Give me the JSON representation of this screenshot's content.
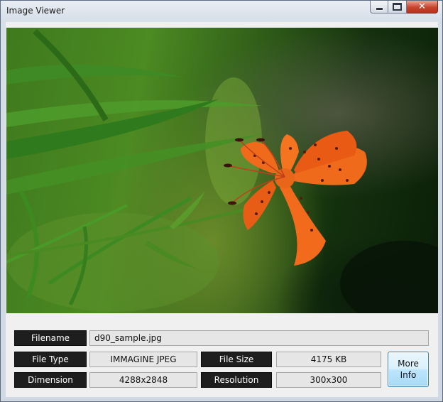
{
  "window": {
    "title": "Image Viewer"
  },
  "fields": {
    "filename": {
      "label": "Filename",
      "value": "d90_sample.jpg"
    },
    "file_type": {
      "label": "File Type",
      "value": "IMMAGINE JPEG"
    },
    "file_size": {
      "label": "File Size",
      "value": "4175 KB"
    },
    "dimension": {
      "label": "Dimension",
      "value": "4288x2848"
    },
    "resolution": {
      "label": "Resolution",
      "value": "300x300"
    }
  },
  "buttons": {
    "more_info": "More Info"
  },
  "icons": [
    "minimize-icon",
    "maximize-icon",
    "close-icon"
  ],
  "colors": {
    "label_bg": "#1e1e1e",
    "value_bg": "#e6e6e6",
    "close_red": "#c7442c",
    "button_blue": "#3c7fb1"
  }
}
